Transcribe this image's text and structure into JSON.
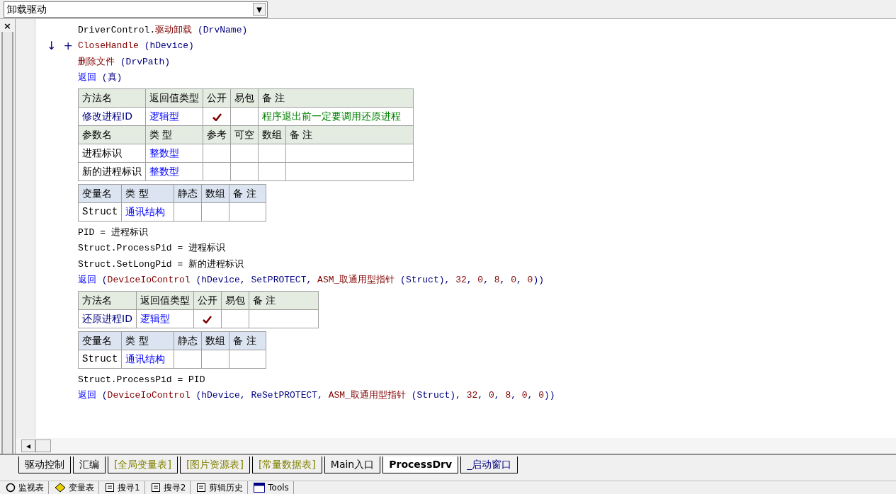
{
  "combo": {
    "value": "卸载驱动",
    "button": "▼"
  },
  "side_panel": {
    "close": "×"
  },
  "code": [
    {
      "kind": "line",
      "tokens": [
        {
          "kind": "plain",
          "text": "DriverControl."
        },
        {
          "kind": "call",
          "text": "驱动卸载"
        },
        {
          "kind": "punct",
          "text": " (DrvName)"
        }
      ]
    },
    {
      "kind": "line",
      "gutter": [
        "↓",
        "+"
      ],
      "tokens": [
        {
          "kind": "call",
          "text": "CloseHandle"
        },
        {
          "kind": "punct",
          "text": " (hDevice)"
        }
      ]
    },
    {
      "kind": "line",
      "tokens": [
        {
          "kind": "call",
          "text": "删除文件"
        },
        {
          "kind": "punct",
          "text": " (DrvPath)"
        }
      ]
    },
    {
      "kind": "line",
      "tokens": [
        {
          "kind": "keyword",
          "text": "返回"
        },
        {
          "kind": "punct",
          "text": " (真)"
        }
      ]
    },
    {
      "kind": "method_table",
      "headers": [
        "方法名",
        "返回值类型",
        "公开",
        "易包",
        "备 注"
      ],
      "name": "修改进程ID",
      "type": "逻辑型",
      "public": true,
      "note": "程序退出前一定要调用还原进程",
      "param_headers": [
        "参数名",
        "类 型",
        "参考",
        "可空",
        "数组",
        "备 注"
      ],
      "params": [
        {
          "name": "进程标识",
          "type": "整数型"
        },
        {
          "name": "新的进程标识",
          "type": "整数型"
        }
      ]
    },
    {
      "kind": "var_table",
      "headers": [
        "变量名",
        "类 型",
        "静态",
        "数组",
        "备 注"
      ],
      "vars": [
        {
          "name": "Struct",
          "type": "通讯结构"
        }
      ]
    },
    {
      "kind": "line",
      "tokens": [
        {
          "kind": "plain",
          "text": "PID = 进程标识"
        }
      ]
    },
    {
      "kind": "line",
      "tokens": [
        {
          "kind": "plain",
          "text": "Struct.ProcessPid = 进程标识"
        }
      ]
    },
    {
      "kind": "line",
      "tokens": [
        {
          "kind": "plain",
          "text": "Struct.SetLongPid = 新的进程标识"
        }
      ]
    },
    {
      "kind": "line",
      "tokens": [
        {
          "kind": "keyword",
          "text": "返回"
        },
        {
          "kind": "punct",
          "text": " ("
        },
        {
          "kind": "call",
          "text": "DeviceIoControl"
        },
        {
          "kind": "punct",
          "text": " (hDevice, SetPROTECT, "
        },
        {
          "kind": "call",
          "text": "ASM_取通用型指针"
        },
        {
          "kind": "punct",
          "text": " (Struct), "
        },
        {
          "kind": "call",
          "text": "32"
        },
        {
          "kind": "punct",
          "text": ", "
        },
        {
          "kind": "call",
          "text": "0"
        },
        {
          "kind": "punct",
          "text": ", "
        },
        {
          "kind": "call",
          "text": "8"
        },
        {
          "kind": "punct",
          "text": ", "
        },
        {
          "kind": "call",
          "text": "0"
        },
        {
          "kind": "punct",
          "text": ", "
        },
        {
          "kind": "call",
          "text": "0"
        },
        {
          "kind": "punct",
          "text": "))"
        }
      ]
    },
    {
      "kind": "method_table",
      "headers": [
        "方法名",
        "返回值类型",
        "公开",
        "易包",
        "备 注"
      ],
      "name": "还原进程ID",
      "type": "逻辑型",
      "public": true
    },
    {
      "kind": "var_table",
      "headers": [
        "变量名",
        "类 型",
        "静态",
        "数组",
        "备 注"
      ],
      "vars": [
        {
          "name": "Struct",
          "type": "通讯结构"
        }
      ]
    },
    {
      "kind": "line",
      "tokens": [
        {
          "kind": "plain",
          "text": "Struct.ProcessPid = PID"
        }
      ]
    },
    {
      "kind": "line",
      "tokens": [
        {
          "kind": "keyword",
          "text": "返回"
        },
        {
          "kind": "punct",
          "text": " ("
        },
        {
          "kind": "call",
          "text": "DeviceIoControl"
        },
        {
          "kind": "punct",
          "text": " (hDevice, ReSetPROTECT, "
        },
        {
          "kind": "call",
          "text": "ASM_取通用型指针"
        },
        {
          "kind": "punct",
          "text": " (Struct), "
        },
        {
          "kind": "call",
          "text": "32"
        },
        {
          "kind": "punct",
          "text": ", "
        },
        {
          "kind": "call",
          "text": "0"
        },
        {
          "kind": "punct",
          "text": ", "
        },
        {
          "kind": "call",
          "text": "8"
        },
        {
          "kind": "punct",
          "text": ", "
        },
        {
          "kind": "call",
          "text": "0"
        },
        {
          "kind": "punct",
          "text": ", "
        },
        {
          "kind": "call",
          "text": "0"
        },
        {
          "kind": "punct",
          "text": "))"
        }
      ]
    }
  ],
  "scroll_left": "◂",
  "tabs": [
    {
      "label": "驱动控制",
      "kind": "module",
      "selected": false
    },
    {
      "label": "汇编",
      "kind": "module",
      "selected": false
    },
    {
      "label": "[全局变量表]",
      "kind": "resource",
      "selected": false
    },
    {
      "label": "[图片资源表]",
      "kind": "resource",
      "selected": false
    },
    {
      "label": "[常量数据表]",
      "kind": "resource",
      "selected": false
    },
    {
      "label": "Main入口",
      "kind": "module",
      "selected": false
    },
    {
      "label": "ProcessDrv",
      "kind": "module",
      "selected": true
    },
    {
      "label": "_启动窗口",
      "kind": "window",
      "selected": false
    }
  ],
  "panel_tabs": [
    {
      "label": "监视表",
      "kind": "watch"
    },
    {
      "label": "变量表",
      "kind": "variables"
    },
    {
      "label": "搜寻1",
      "kind": "search"
    },
    {
      "label": "搜寻2",
      "kind": "search"
    },
    {
      "label": "剪辑历史",
      "kind": "history"
    },
    {
      "label": "Tools",
      "kind": "tools"
    }
  ]
}
